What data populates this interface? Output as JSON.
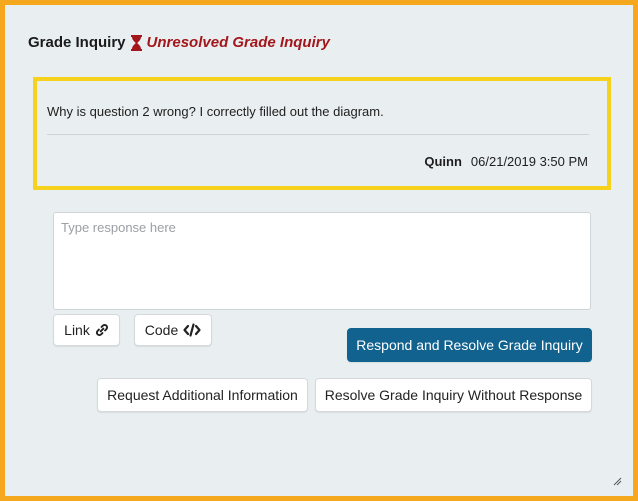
{
  "header": {
    "title": "Grade Inquiry",
    "status_icon": "hourglass-icon",
    "status": "Unresolved Grade Inquiry",
    "status_color": "#a3161b"
  },
  "message": {
    "text": "Why is question 2 wrong? I correctly filled out the diagram.",
    "author": "Quinn",
    "timestamp": "06/21/2019 3:50 PM"
  },
  "response": {
    "placeholder": "Type response here",
    "value": ""
  },
  "toolbar": {
    "link_label": "Link",
    "link_icon": "link-icon",
    "code_label": "Code",
    "code_icon": "code-icon"
  },
  "actions": {
    "respond_resolve_label": "Respond and Resolve Grade Inquiry",
    "request_info_label": "Request Additional Information",
    "resolve_without_label": "Resolve Grade Inquiry Without Response"
  },
  "colors": {
    "frame_border": "#f5a81e",
    "card_border": "#f7d21c",
    "primary": "#11628f",
    "background": "#e9eff0"
  }
}
